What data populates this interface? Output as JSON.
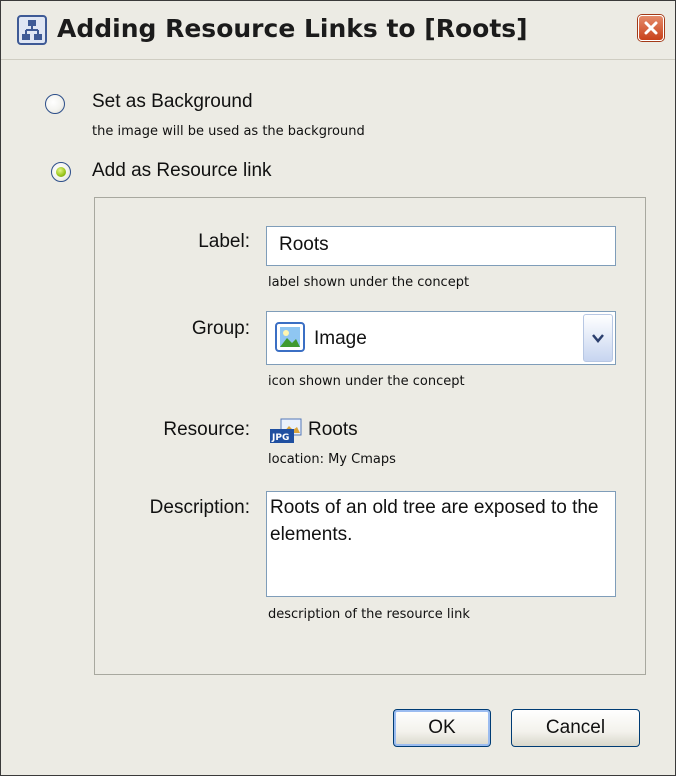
{
  "window": {
    "title": "Adding Resource Links to [Roots]",
    "title_icon": "cmap-tools-icon",
    "close_icon": "close-x-icon"
  },
  "options": [
    {
      "label": "Set as Background",
      "description": "the image will be used as the background",
      "selected": false
    },
    {
      "label": "Add as Resource link",
      "description": "",
      "selected": true
    }
  ],
  "form": {
    "label": {
      "caption": "Label:",
      "value": "Roots",
      "hint": "label shown under the concept"
    },
    "group": {
      "caption": "Group:",
      "value": "Image",
      "hint": "icon shown under the concept",
      "icon": "image-icon",
      "arrow_icon": "chevron-down-icon"
    },
    "resource": {
      "caption": "Resource:",
      "name": "Roots",
      "location": "location: My Cmaps",
      "icon": "jpg-file-icon"
    },
    "description": {
      "caption": "Description:",
      "value": "Roots of an old tree are exposed to the elements.",
      "hint": "description of the resource link"
    }
  },
  "buttons": {
    "ok": "OK",
    "cancel": "Cancel"
  },
  "colors": {
    "window_bg": "#ecebe4",
    "field_border": "#7f9db9",
    "close_button": "#c8411b",
    "radio_selected": "#9ec91f"
  }
}
